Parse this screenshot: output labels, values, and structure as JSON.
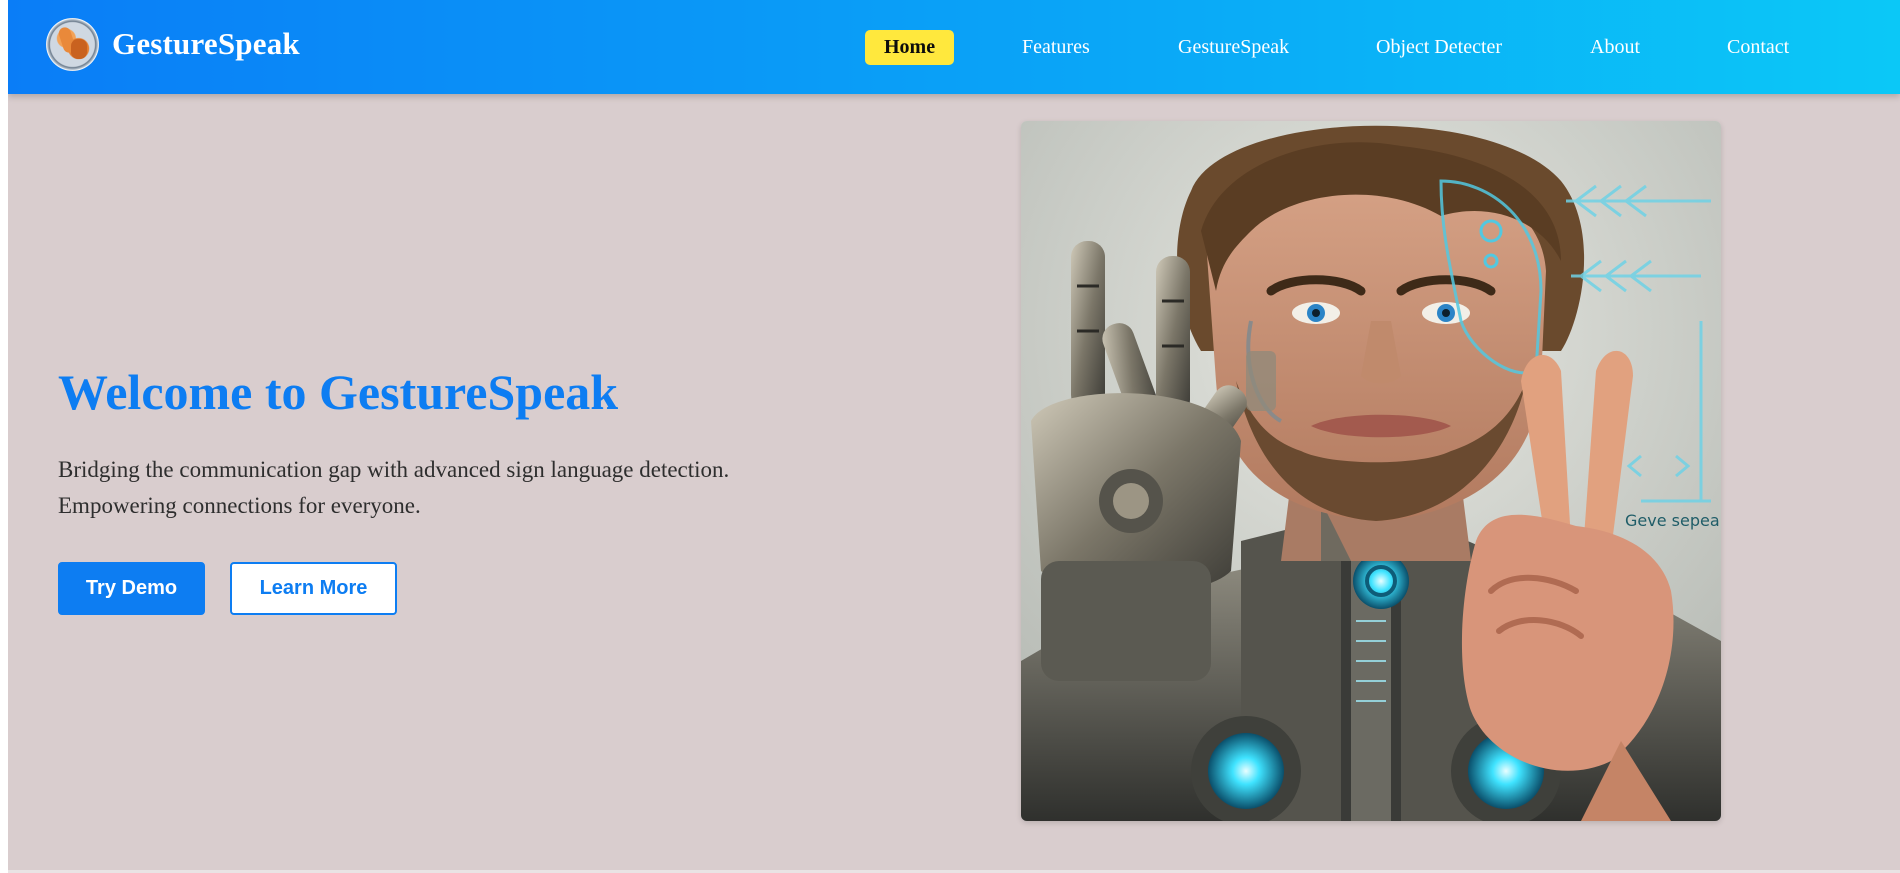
{
  "brand": {
    "name": "GestureSpeak",
    "logo_icon": "hand-gesture-logo-icon"
  },
  "nav": {
    "items": [
      {
        "label": "Home",
        "active": true
      },
      {
        "label": "Features",
        "active": false
      },
      {
        "label": "GestureSpeak",
        "active": false
      },
      {
        "label": "Object Detecter",
        "active": false
      },
      {
        "label": "About",
        "active": false
      },
      {
        "label": "Contact",
        "active": false
      }
    ]
  },
  "hero": {
    "title": "Welcome to GestureSpeak",
    "description": "Bridging the communication gap with advanced sign language detection. Empowering connections for everyone.",
    "primary_button": "Try Demo",
    "secondary_button": "Learn More",
    "image_alt": "Cyborg man making a peace-sign gesture with a human hand and a robotic hand",
    "image_text": "Geve sepeak"
  },
  "colors": {
    "accent": "#0d7df2",
    "active_nav": "#ffe83d",
    "page_bg": "#d9cdce"
  }
}
